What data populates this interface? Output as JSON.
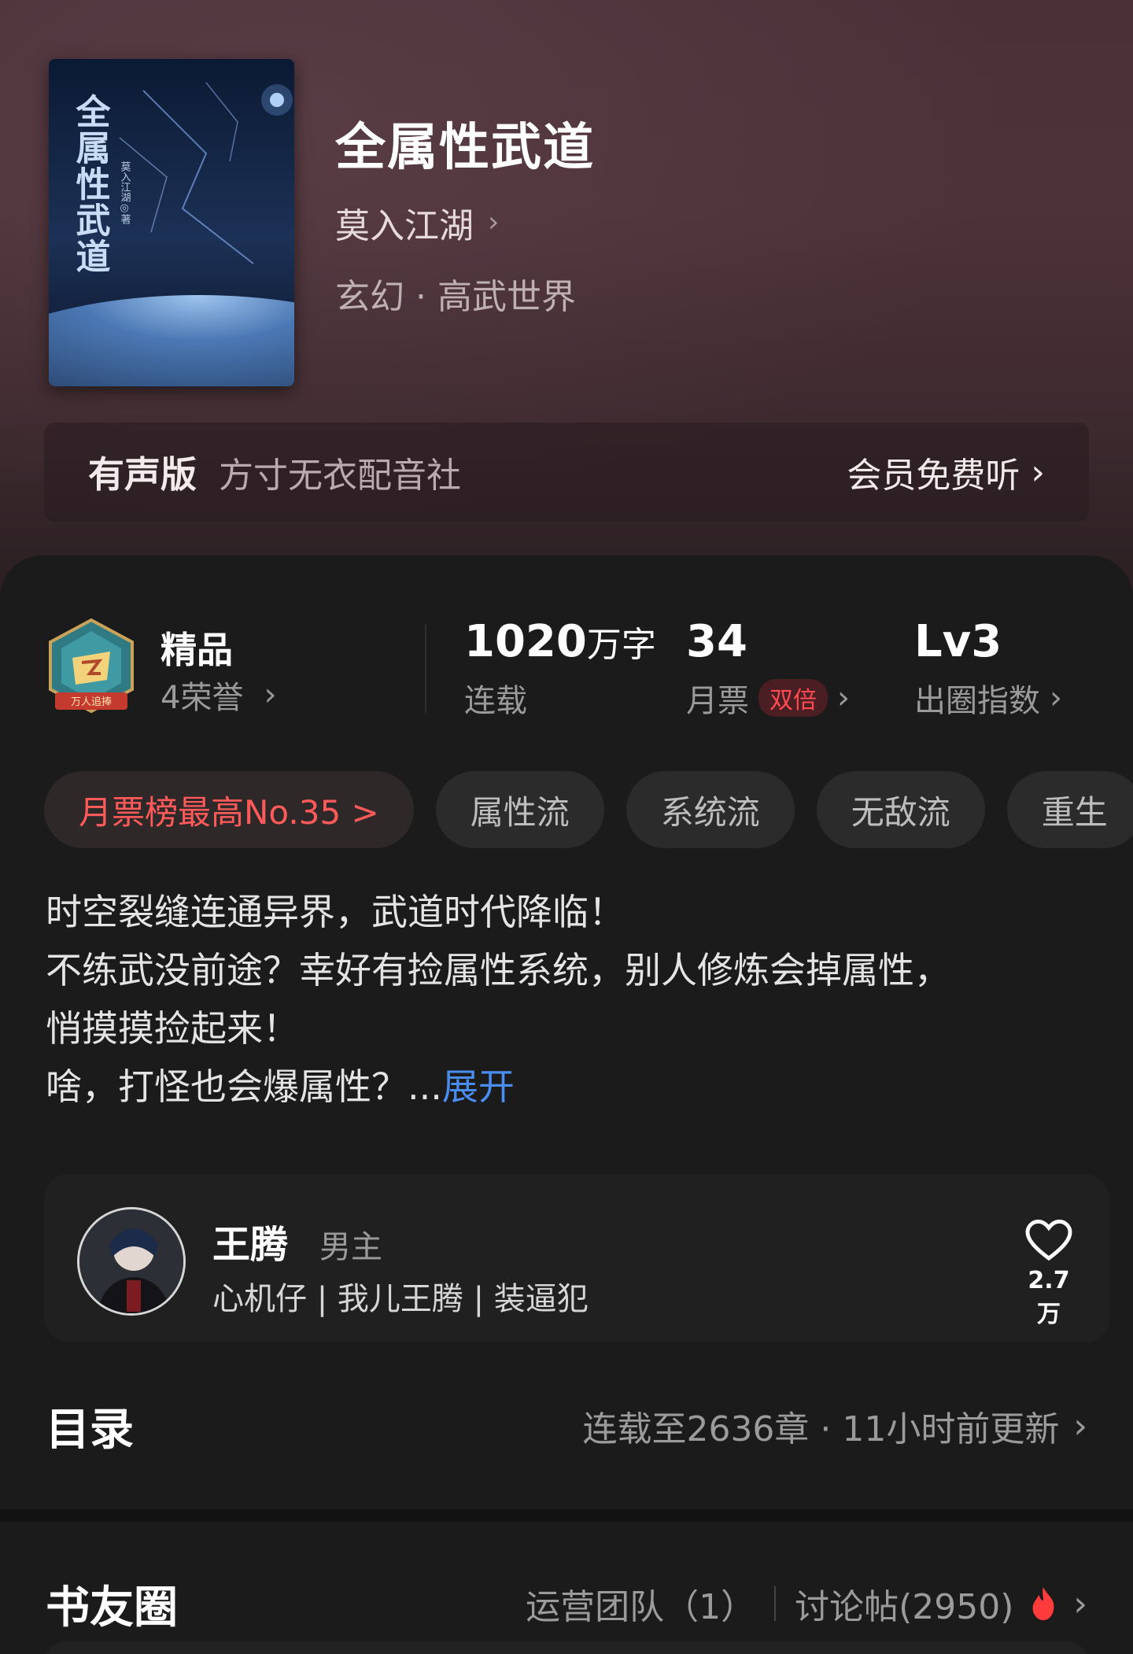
{
  "book": {
    "title": "全属性武道",
    "author": "莫入江湖",
    "genre": "玄幻 · 高武世界",
    "cover": {
      "title_text": "全属性武道",
      "author_text": "莫入江湖◎著"
    }
  },
  "audio": {
    "label": "有声版",
    "studio": "方寸无衣配音社",
    "cta": "会员免费听"
  },
  "stats": {
    "badge_caption": "万人追捧",
    "quality": "精品",
    "honors": "4荣誉",
    "words_num": "1020",
    "words_unit": "万字",
    "status": "连载",
    "tickets_num": "34",
    "tickets_label": "月票",
    "tickets_badge": "双倍",
    "level": "Lv3",
    "level_label": "出圈指数"
  },
  "tags": [
    "月票榜最高No.35 >",
    "属性流",
    "系统流",
    "无敌流",
    "重生"
  ],
  "synopsis": {
    "lines": [
      "时空裂缝连通异界，武道时代降临！",
      "不练武没前途？幸好有捡属性系统，别人修炼会掉属性，",
      "悄摸摸捡起来！",
      "啥，打怪也会爆属性？..."
    ],
    "expand": "展开"
  },
  "character": {
    "name": "王腾",
    "role": "男主",
    "traits": "心机仔 | 我儿王腾 | 装逼犯",
    "likes": "2.7万"
  },
  "catalog": {
    "title": "目录",
    "meta": "连载至2636章 · 11小时前更新"
  },
  "circle": {
    "title": "书友圈",
    "ops": "运营团队（1）",
    "posts": "讨论帖(2950)"
  },
  "colors": {
    "accent_red": "#ff5a5a",
    "link_blue": "#4a8df0",
    "hero_bg": "#4a3138",
    "panel_bg": "#1b1b1c"
  }
}
